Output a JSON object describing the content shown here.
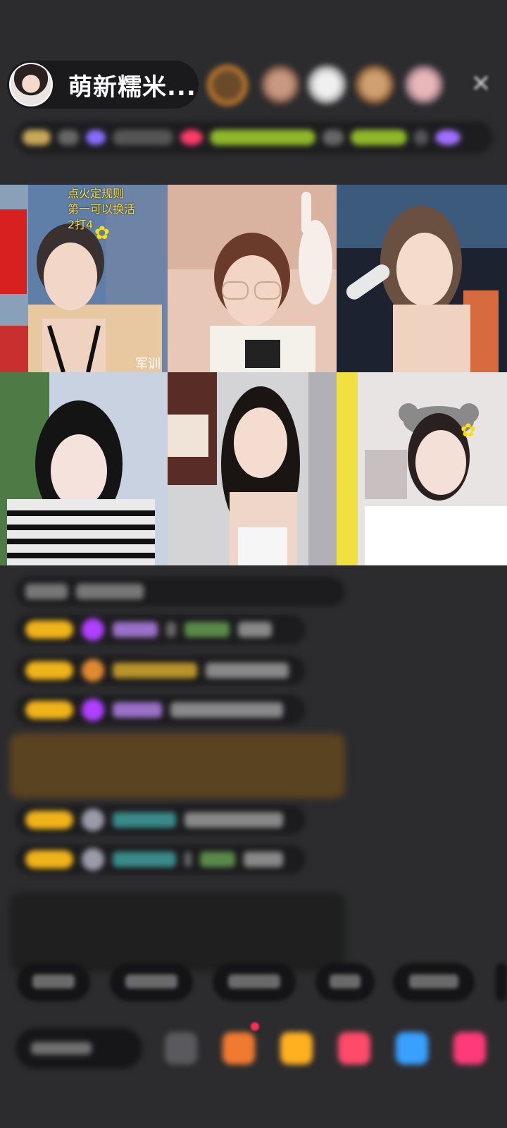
{
  "header": {
    "host_name": "萌新糯米...",
    "viewer_count": 5,
    "close_icon": "close-icon"
  },
  "grid": {
    "cells": [
      {
        "id": "seat-1",
        "overlay_text": "点火定规则\n第一可以换活\n2打4",
        "corner_text": "军训"
      },
      {
        "id": "seat-2"
      },
      {
        "id": "seat-3"
      },
      {
        "id": "seat-4"
      },
      {
        "id": "seat-5"
      },
      {
        "id": "seat-6"
      }
    ]
  },
  "chat": {
    "messages_count": 9,
    "note": ""
  },
  "quick_replies": {
    "count": 6
  },
  "bottom_bar": {
    "icons": [
      "emoji-icon",
      "gift-box-icon",
      "gift-bag-icon",
      "heart-gift-icon",
      "game-icon",
      "more-gift-icon"
    ]
  },
  "colors": {
    "background": "#2c2c2e",
    "badge": "#f0b31a",
    "overlay_text": "#ffe24a"
  }
}
